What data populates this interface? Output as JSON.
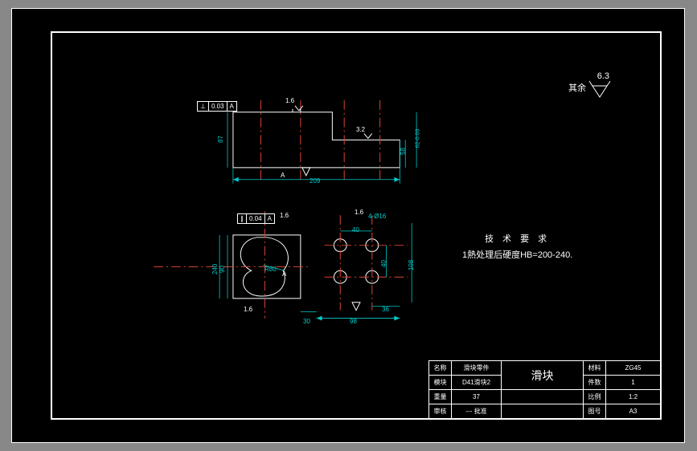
{
  "surface_note": "其余",
  "surface_value": "6.3",
  "tech_req_title": "技 术 要 求",
  "tech_req_line1": "1熱处理后硬度HB=200-240.",
  "top_view": {
    "width": "209",
    "height_left": "87",
    "notch_h": "58",
    "notch_tol": "62-0.03",
    "gdt_perp": "⊥",
    "gdt_tol": "0.03",
    "gdt_datum": "A",
    "sf1": "1.6",
    "sf2": "3.2",
    "datum_label": "A"
  },
  "bottom_view": {
    "total_w": "98",
    "left_w": "30",
    "right_w": "36",
    "hole_pitch_x": "40",
    "hole_pitch_y": "40",
    "height": "108",
    "left_h": "90",
    "left_sub": "240",
    "hole_callout": "4-Ø16",
    "rad": "R80",
    "gdt_par": "∥",
    "gdt_tol": "0.04",
    "gdt_datum": "A",
    "sf1": "1.6",
    "sf2": "1.6",
    "sf3": "1.6",
    "datum_label": "A"
  },
  "title_block": {
    "r1c1": "名称",
    "r1c2": "滑块零件",
    "r1c4": "材料",
    "r1c5": "ZG45",
    "r2c1": "模块",
    "r2c2": "D41滑块2",
    "r2c4": "件数",
    "r2c5": "1",
    "r3c1": "重量",
    "r3c2": "37",
    "r3c4": "比例",
    "r3c5": "1:2",
    "r4c1": "审核",
    "r4c2": "--- 批准",
    "r4c4": "图号",
    "r4c5": "A3",
    "part_name": "滑块"
  }
}
